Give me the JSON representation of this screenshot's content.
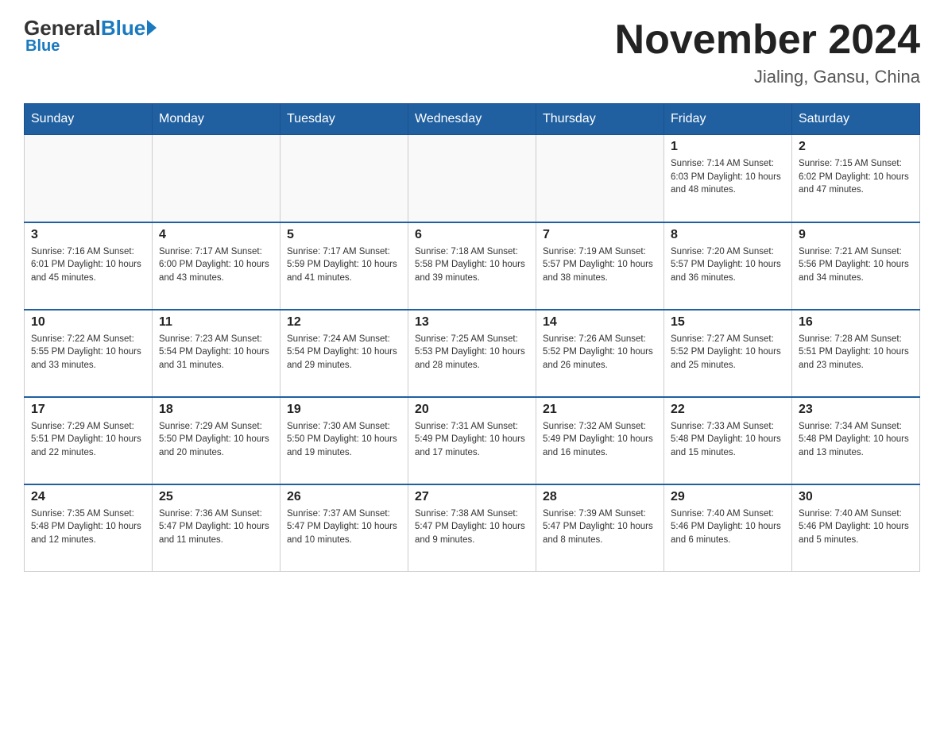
{
  "header": {
    "logo_general": "General",
    "logo_blue": "Blue",
    "title": "November 2024",
    "subtitle": "Jialing, Gansu, China"
  },
  "weekdays": [
    "Sunday",
    "Monday",
    "Tuesday",
    "Wednesday",
    "Thursday",
    "Friday",
    "Saturday"
  ],
  "weeks": [
    [
      {
        "day": "",
        "info": ""
      },
      {
        "day": "",
        "info": ""
      },
      {
        "day": "",
        "info": ""
      },
      {
        "day": "",
        "info": ""
      },
      {
        "day": "",
        "info": ""
      },
      {
        "day": "1",
        "info": "Sunrise: 7:14 AM\nSunset: 6:03 PM\nDaylight: 10 hours\nand 48 minutes."
      },
      {
        "day": "2",
        "info": "Sunrise: 7:15 AM\nSunset: 6:02 PM\nDaylight: 10 hours\nand 47 minutes."
      }
    ],
    [
      {
        "day": "3",
        "info": "Sunrise: 7:16 AM\nSunset: 6:01 PM\nDaylight: 10 hours\nand 45 minutes."
      },
      {
        "day": "4",
        "info": "Sunrise: 7:17 AM\nSunset: 6:00 PM\nDaylight: 10 hours\nand 43 minutes."
      },
      {
        "day": "5",
        "info": "Sunrise: 7:17 AM\nSunset: 5:59 PM\nDaylight: 10 hours\nand 41 minutes."
      },
      {
        "day": "6",
        "info": "Sunrise: 7:18 AM\nSunset: 5:58 PM\nDaylight: 10 hours\nand 39 minutes."
      },
      {
        "day": "7",
        "info": "Sunrise: 7:19 AM\nSunset: 5:57 PM\nDaylight: 10 hours\nand 38 minutes."
      },
      {
        "day": "8",
        "info": "Sunrise: 7:20 AM\nSunset: 5:57 PM\nDaylight: 10 hours\nand 36 minutes."
      },
      {
        "day": "9",
        "info": "Sunrise: 7:21 AM\nSunset: 5:56 PM\nDaylight: 10 hours\nand 34 minutes."
      }
    ],
    [
      {
        "day": "10",
        "info": "Sunrise: 7:22 AM\nSunset: 5:55 PM\nDaylight: 10 hours\nand 33 minutes."
      },
      {
        "day": "11",
        "info": "Sunrise: 7:23 AM\nSunset: 5:54 PM\nDaylight: 10 hours\nand 31 minutes."
      },
      {
        "day": "12",
        "info": "Sunrise: 7:24 AM\nSunset: 5:54 PM\nDaylight: 10 hours\nand 29 minutes."
      },
      {
        "day": "13",
        "info": "Sunrise: 7:25 AM\nSunset: 5:53 PM\nDaylight: 10 hours\nand 28 minutes."
      },
      {
        "day": "14",
        "info": "Sunrise: 7:26 AM\nSunset: 5:52 PM\nDaylight: 10 hours\nand 26 minutes."
      },
      {
        "day": "15",
        "info": "Sunrise: 7:27 AM\nSunset: 5:52 PM\nDaylight: 10 hours\nand 25 minutes."
      },
      {
        "day": "16",
        "info": "Sunrise: 7:28 AM\nSunset: 5:51 PM\nDaylight: 10 hours\nand 23 minutes."
      }
    ],
    [
      {
        "day": "17",
        "info": "Sunrise: 7:29 AM\nSunset: 5:51 PM\nDaylight: 10 hours\nand 22 minutes."
      },
      {
        "day": "18",
        "info": "Sunrise: 7:29 AM\nSunset: 5:50 PM\nDaylight: 10 hours\nand 20 minutes."
      },
      {
        "day": "19",
        "info": "Sunrise: 7:30 AM\nSunset: 5:50 PM\nDaylight: 10 hours\nand 19 minutes."
      },
      {
        "day": "20",
        "info": "Sunrise: 7:31 AM\nSunset: 5:49 PM\nDaylight: 10 hours\nand 17 minutes."
      },
      {
        "day": "21",
        "info": "Sunrise: 7:32 AM\nSunset: 5:49 PM\nDaylight: 10 hours\nand 16 minutes."
      },
      {
        "day": "22",
        "info": "Sunrise: 7:33 AM\nSunset: 5:48 PM\nDaylight: 10 hours\nand 15 minutes."
      },
      {
        "day": "23",
        "info": "Sunrise: 7:34 AM\nSunset: 5:48 PM\nDaylight: 10 hours\nand 13 minutes."
      }
    ],
    [
      {
        "day": "24",
        "info": "Sunrise: 7:35 AM\nSunset: 5:48 PM\nDaylight: 10 hours\nand 12 minutes."
      },
      {
        "day": "25",
        "info": "Sunrise: 7:36 AM\nSunset: 5:47 PM\nDaylight: 10 hours\nand 11 minutes."
      },
      {
        "day": "26",
        "info": "Sunrise: 7:37 AM\nSunset: 5:47 PM\nDaylight: 10 hours\nand 10 minutes."
      },
      {
        "day": "27",
        "info": "Sunrise: 7:38 AM\nSunset: 5:47 PM\nDaylight: 10 hours\nand 9 minutes."
      },
      {
        "day": "28",
        "info": "Sunrise: 7:39 AM\nSunset: 5:47 PM\nDaylight: 10 hours\nand 8 minutes."
      },
      {
        "day": "29",
        "info": "Sunrise: 7:40 AM\nSunset: 5:46 PM\nDaylight: 10 hours\nand 6 minutes."
      },
      {
        "day": "30",
        "info": "Sunrise: 7:40 AM\nSunset: 5:46 PM\nDaylight: 10 hours\nand 5 minutes."
      }
    ]
  ]
}
